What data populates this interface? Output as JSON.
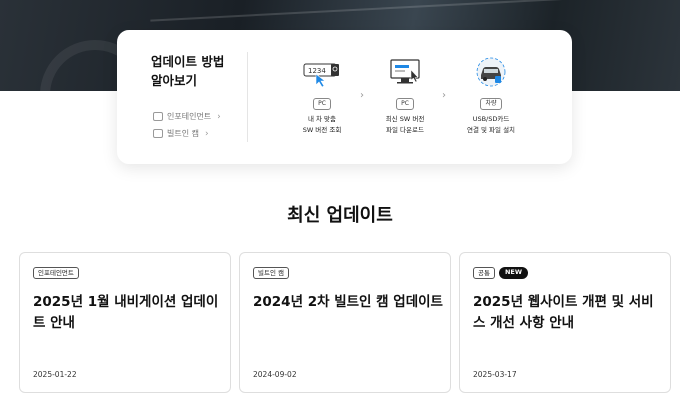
{
  "guide": {
    "title_line1": "업데이트 방법",
    "title_line2": "알아보기",
    "links": [
      {
        "label": "인포테인먼트",
        "icon": "car-screen-icon"
      },
      {
        "label": "빌트인 캠",
        "icon": "camera-icon"
      }
    ],
    "steps": [
      {
        "tag": "PC",
        "caption_line1": "내 차 맞춤",
        "caption_line2": "SW 버전 조회",
        "icon": "search-version-icon",
        "code": "1234"
      },
      {
        "tag": "PC",
        "caption_line1": "최신 SW 버전",
        "caption_line2": "파일 다운로드",
        "icon": "monitor-download-icon"
      },
      {
        "tag": "차량",
        "caption_line1": "USB/SD카드",
        "caption_line2": "연결 및 파일 설치",
        "icon": "car-install-icon"
      }
    ]
  },
  "latest": {
    "title": "최신 업데이트",
    "cards": [
      {
        "tags": [
          "인포테인먼트"
        ],
        "badge": "",
        "title": "2025년 1월 내비게이션 업데이트 안내",
        "date": "2025-01-22"
      },
      {
        "tags": [
          "빌트인 캠"
        ],
        "badge": "",
        "title": "2024년 2차 빌트인 캠 업데이트",
        "date": "2024-09-02"
      },
      {
        "tags": [
          "공통"
        ],
        "badge": "NEW",
        "title": "2025년 웹사이트 개편 및 서비스 개선 사항 안내",
        "date": "2025-03-17"
      }
    ]
  },
  "colors": {
    "accent": "#1e88e5",
    "dark": "#111111"
  }
}
